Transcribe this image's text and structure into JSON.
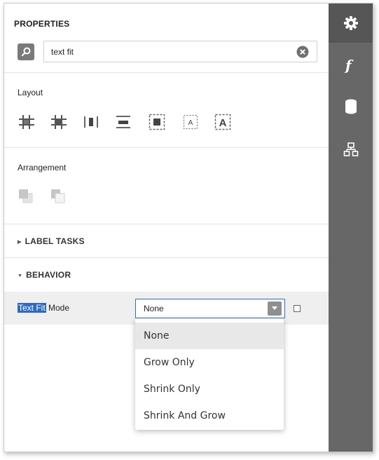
{
  "header": {
    "title": "PROPERTIES"
  },
  "search": {
    "value": "text fit"
  },
  "sections": {
    "layout": {
      "label": "Layout"
    },
    "arrangement": {
      "label": "Arrangement"
    }
  },
  "groups": {
    "label_tasks": {
      "label": "LABEL TASKS",
      "expanded": false
    },
    "behavior": {
      "label": "BEHAVIOR",
      "expanded": true
    }
  },
  "property": {
    "label_highlight": "Text Fit",
    "label_rest": " Mode",
    "value": "None"
  },
  "dropdown": {
    "options": [
      "None",
      "Grow Only",
      "Shrink Only",
      "Shrink And Grow"
    ],
    "selected": "None"
  },
  "sidebar": {
    "tabs": [
      {
        "icon": "gear-icon",
        "active": true
      },
      {
        "icon": "function-icon",
        "label": "f",
        "active": false
      },
      {
        "icon": "database-icon",
        "active": false
      },
      {
        "icon": "report-explorer-icon",
        "active": false
      }
    ]
  },
  "colors": {
    "sidebar_bg": "#676767",
    "sidebar_active": "#565656",
    "accent": "#2c6bbf",
    "row_bg": "#efefef"
  }
}
